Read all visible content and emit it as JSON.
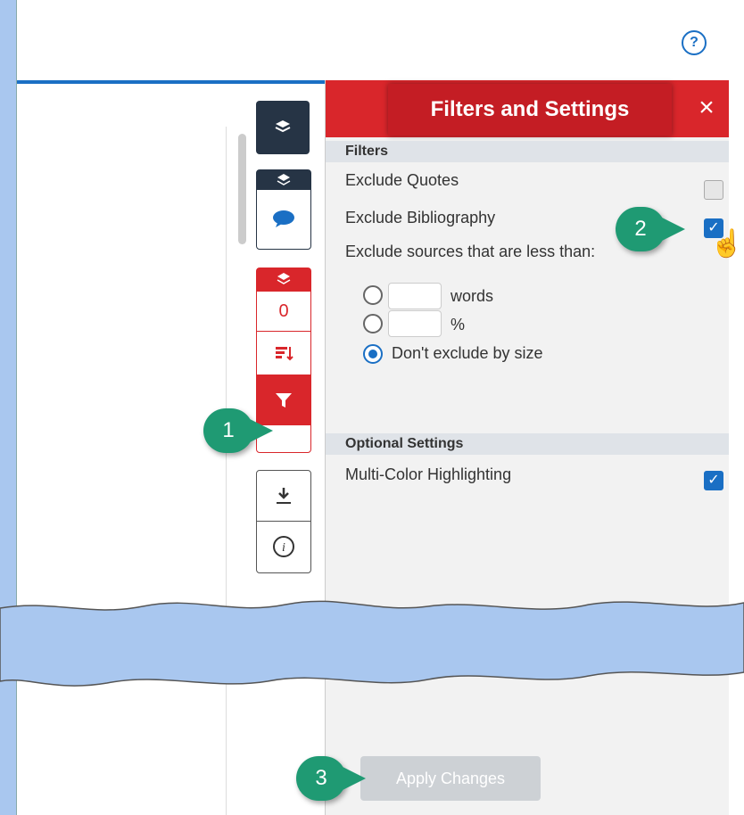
{
  "help": {
    "label": "?"
  },
  "toolbar": {
    "layers_icon": "layers-icon",
    "comment_icon": "comment-icon",
    "match_count": "0",
    "sort_icon": "sort-icon",
    "filter_icon": "filter-icon",
    "download_icon": "download-icon",
    "info_icon": "info-icon"
  },
  "panel": {
    "title": "Filters and Settings",
    "close": "×",
    "filters_section": "Filters",
    "exclude_quotes": "Exclude Quotes",
    "exclude_quotes_checked": false,
    "exclude_bibliography": "Exclude Bibliography",
    "exclude_bibliography_checked": true,
    "exclude_sources_label": "Exclude sources that are less than:",
    "words_label": "words",
    "percent_label": "%",
    "dont_exclude_label": "Don't exclude by size",
    "optional_section": "Optional Settings",
    "multicolor_label": "Multi-Color Highlighting",
    "multicolor_checked": true,
    "apply_button": "Apply Changes"
  },
  "callouts": {
    "one": "1",
    "two": "2",
    "three": "3"
  },
  "colors": {
    "accent_red": "#d9262b",
    "accent_blue": "#1a6fc4",
    "callout_green": "#1f9a73"
  }
}
